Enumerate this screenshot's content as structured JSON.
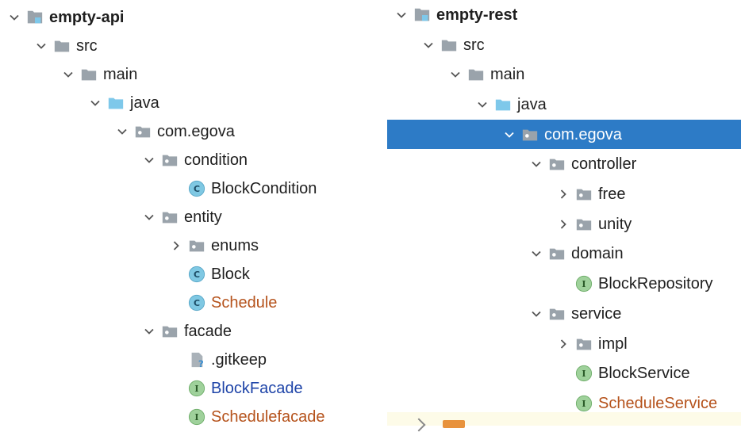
{
  "colors": {
    "selection": "#2d7bc6",
    "folder": "#9aa3ab",
    "source_folder": "#7ec8ea",
    "class_icon": "#7fc8e3",
    "interface_icon": "#9fd19b",
    "modified_text": "#b5521b",
    "added_text": "#1e44a8"
  },
  "left_tree": [
    {
      "label": "empty-api",
      "arrow": "down",
      "icon": "module-icon",
      "level": 0,
      "style": "bold"
    },
    {
      "label": "src",
      "arrow": "down",
      "icon": "folder-icon",
      "level": 1
    },
    {
      "label": "main",
      "arrow": "down",
      "icon": "folder-icon",
      "level": 2
    },
    {
      "label": "java",
      "arrow": "down",
      "icon": "source-folder-icon",
      "level": 3
    },
    {
      "label": "com.egova",
      "arrow": "down",
      "icon": "package-icon",
      "level": 4
    },
    {
      "label": "condition",
      "arrow": "down",
      "icon": "package-icon",
      "level": 5
    },
    {
      "label": "BlockCondition",
      "arrow": "none",
      "icon": "class-icon",
      "level": 6
    },
    {
      "label": "entity",
      "arrow": "down",
      "icon": "package-icon",
      "level": 5
    },
    {
      "label": "enums",
      "arrow": "right",
      "icon": "package-icon",
      "level": 6
    },
    {
      "label": "Block",
      "arrow": "none",
      "icon": "class-icon",
      "level": 6
    },
    {
      "label": "Schedule",
      "arrow": "none",
      "icon": "class-icon",
      "level": 6,
      "style": "modified"
    },
    {
      "label": "facade",
      "arrow": "down",
      "icon": "package-icon",
      "level": 5
    },
    {
      "label": ".gitkeep",
      "arrow": "none",
      "icon": "unknown-file-icon",
      "level": 6
    },
    {
      "label": "BlockFacade",
      "arrow": "none",
      "icon": "interface-icon",
      "level": 6,
      "style": "added"
    },
    {
      "label": "Schedulefacade",
      "arrow": "none",
      "icon": "interface-icon",
      "level": 6,
      "style": "modified"
    }
  ],
  "right_tree": [
    {
      "label": "empty-rest",
      "arrow": "down",
      "icon": "module-icon",
      "level": 0,
      "style": "bold"
    },
    {
      "label": "src",
      "arrow": "down",
      "icon": "folder-icon",
      "level": 1
    },
    {
      "label": "main",
      "arrow": "down",
      "icon": "folder-icon",
      "level": 2
    },
    {
      "label": "java",
      "arrow": "down",
      "icon": "source-folder-icon",
      "level": 3
    },
    {
      "label": "com.egova",
      "arrow": "down",
      "icon": "package-icon",
      "level": 4,
      "selected": true
    },
    {
      "label": "controller",
      "arrow": "down",
      "icon": "package-icon",
      "level": 5
    },
    {
      "label": "free",
      "arrow": "right",
      "icon": "package-icon",
      "level": 6
    },
    {
      "label": "unity",
      "arrow": "right",
      "icon": "package-icon",
      "level": 6
    },
    {
      "label": "domain",
      "arrow": "down",
      "icon": "package-icon",
      "level": 5
    },
    {
      "label": "BlockRepository",
      "arrow": "none",
      "icon": "interface-icon",
      "level": 6
    },
    {
      "label": "service",
      "arrow": "down",
      "icon": "package-icon",
      "level": 5
    },
    {
      "label": "impl",
      "arrow": "right",
      "icon": "package-icon",
      "level": 6
    },
    {
      "label": "BlockService",
      "arrow": "none",
      "icon": "interface-icon",
      "level": 6
    },
    {
      "label": "ScheduleService",
      "arrow": "none",
      "icon": "interface-icon",
      "level": 6,
      "style": "modified"
    }
  ]
}
